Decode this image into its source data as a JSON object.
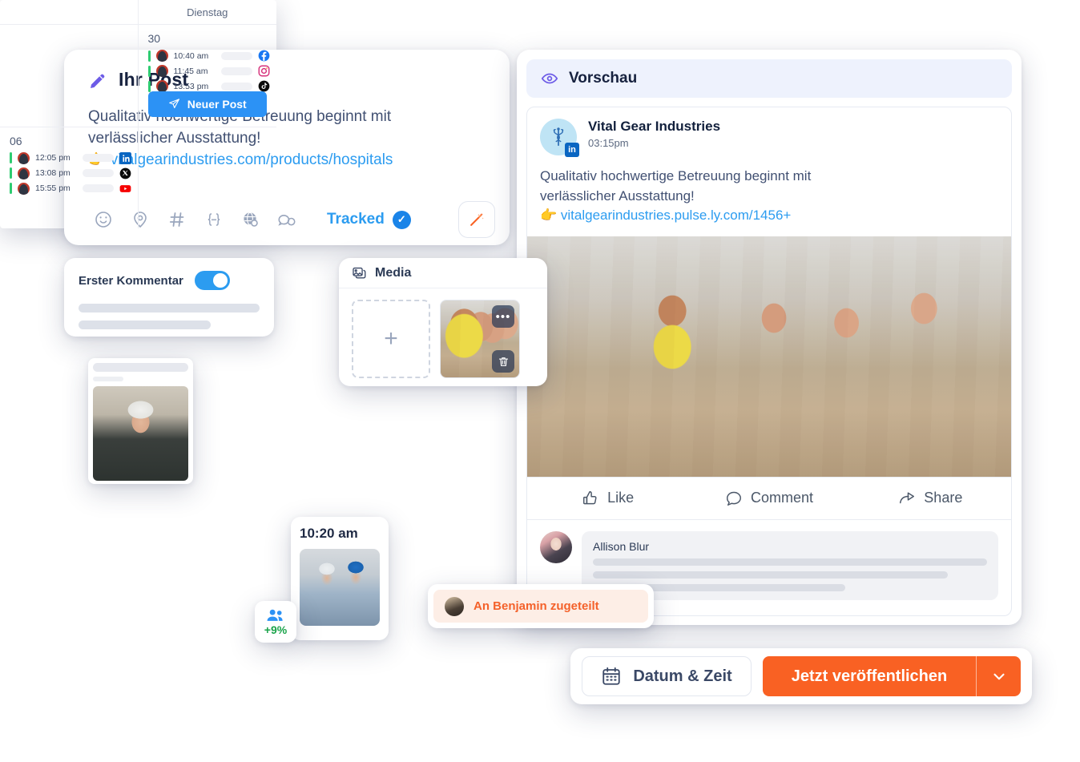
{
  "post_card": {
    "title": "Ihr Post",
    "icon": "pencil-icon",
    "body_line1": "Qualitativ hochwertige Betreuung beginnt mit",
    "body_line2": "verlässlicher Ausstattung!",
    "link_emoji": "👉",
    "link": "vitalgearindustries.com/products/hospitals",
    "toolbar": {
      "icons": [
        "emoji-icon",
        "location-pin-icon",
        "hashtag-icon",
        "variable-braces-icon",
        "globe-icon",
        "chat-bubbles-icon"
      ],
      "tracked_label": "Tracked",
      "tracked_checked": true,
      "ai_wand_icon": "magic-wand-icon"
    }
  },
  "first_comment_card": {
    "label": "Erster Kommentar",
    "toggle_on": true
  },
  "media_card": {
    "title": "Media",
    "icon": "image-stack-icon",
    "add_label": "+",
    "thumb_menu_icon": "more-dots-icon",
    "thumb_delete_icon": "trash-icon"
  },
  "calendar": {
    "day_header": "Dienstag",
    "cells": [
      {
        "number": "30",
        "events": [
          {
            "time": "10:40 am",
            "network": "facebook"
          },
          {
            "time": "11:45 am",
            "network": "instagram"
          },
          {
            "time": "13:53 pm",
            "network": "tiktok"
          }
        ],
        "button": "Neuer Post"
      },
      {
        "number": "06",
        "events": [
          {
            "time": "12:05 pm",
            "network": "linkedin"
          },
          {
            "time": "13:08 pm",
            "network": "x"
          },
          {
            "time": "15:55 pm",
            "network": "youtube"
          }
        ]
      }
    ]
  },
  "time_card": {
    "time": "10:20 am"
  },
  "percent_badge": {
    "value": "+9%",
    "icon": "people-icon"
  },
  "toast": {
    "text": "An Benjamin zugeteilt"
  },
  "preview": {
    "header": {
      "title": "Vorschau",
      "icon": "eye-icon"
    },
    "post": {
      "author": "Vital Gear Industries",
      "time": "03:15pm",
      "network_badge": "in",
      "avatar_icon": "caduceus-icon",
      "text_line1": "Qualitativ hochwertige Betreuung beginnt mit",
      "text_line2": "verlässlicher Ausstattung!",
      "link_emoji": "👉",
      "link": "vitalgearindustries.pulse.ly.com/1456+",
      "actions": [
        {
          "label": "Like",
          "icon": "thumbs-up-icon"
        },
        {
          "label": "Comment",
          "icon": "comment-bubble-icon"
        },
        {
          "label": "Share",
          "icon": "share-arrow-icon"
        }
      ],
      "comment": {
        "author": "Allison Blur"
      }
    }
  },
  "bottom_bar": {
    "date_time_label": "Datum & Zeit",
    "date_time_icon": "calendar-icon",
    "publish_label": "Jetzt veröffentlichen",
    "caret_icon": "chevron-down-icon"
  },
  "colors": {
    "accent_orange": "#f96123",
    "accent_blue": "#2c9cf0",
    "purple": "#6d5ce7",
    "green": "#1aa34a",
    "dark_text": "#16213e"
  }
}
